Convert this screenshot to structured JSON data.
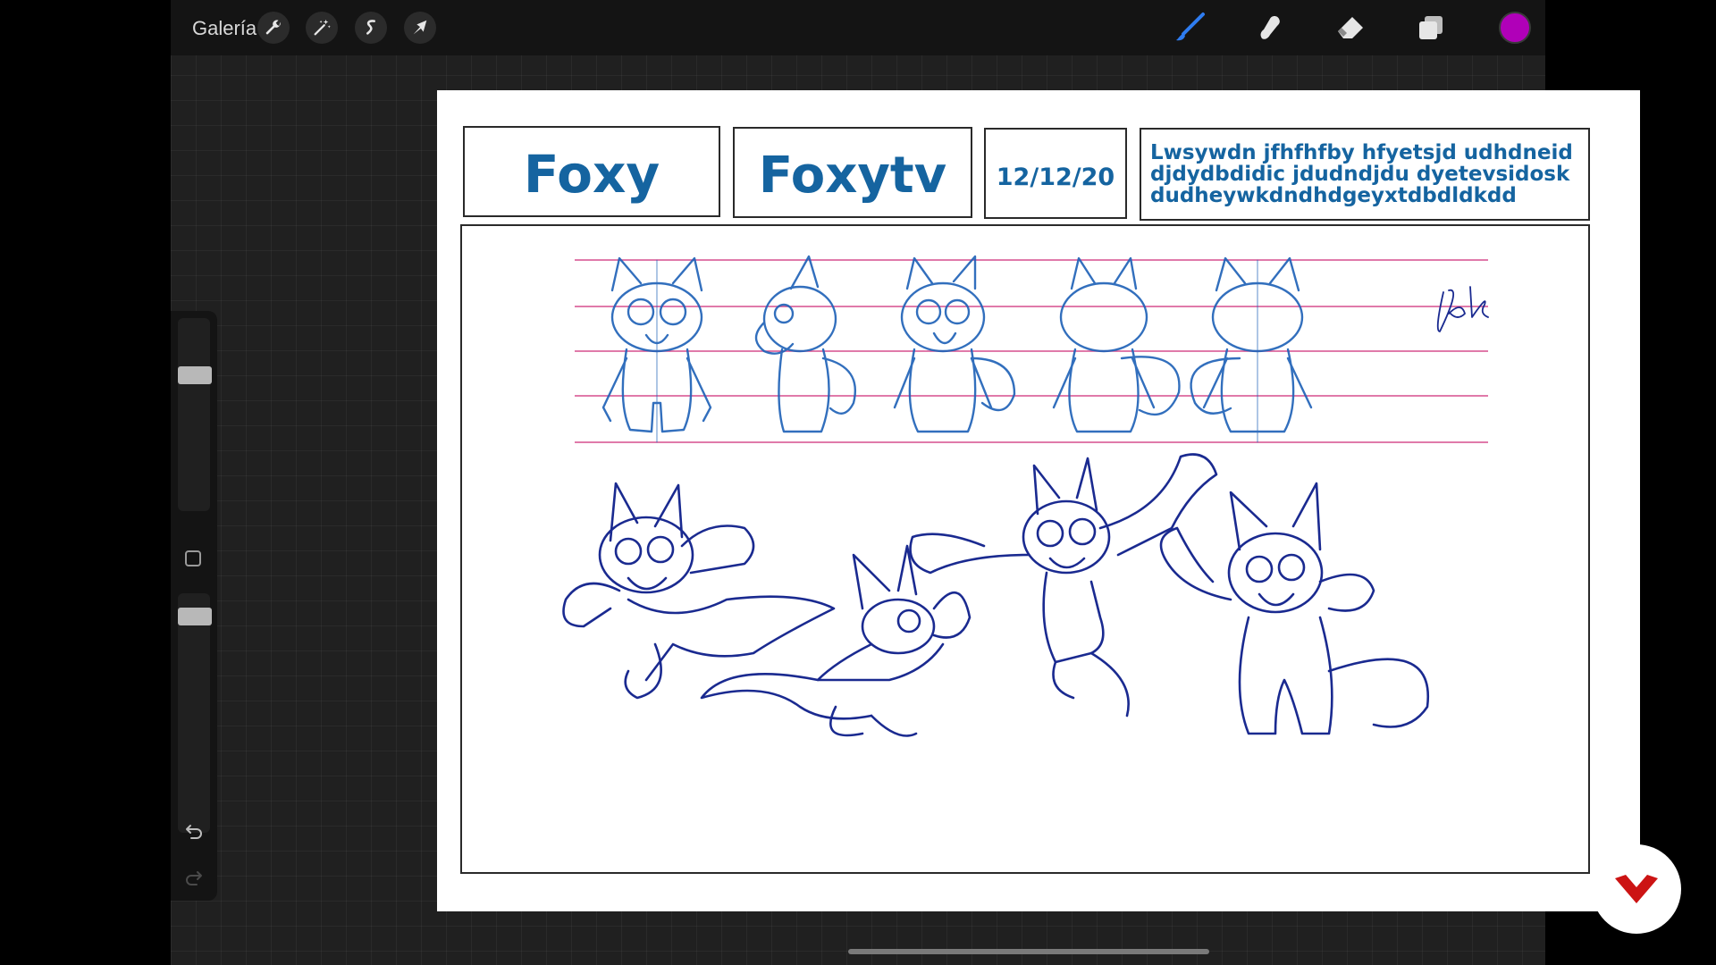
{
  "toolbar": {
    "gallery_label": "Galería",
    "left_tools": [
      "wrench-icon",
      "magic-wand-icon",
      "selection-icon",
      "transform-icon"
    ],
    "right_tools": [
      "brush-icon",
      "smudge-icon",
      "eraser-icon",
      "layers-icon"
    ],
    "current_color": "#b000b8"
  },
  "sidebar": {
    "tools": [
      "brush-size-slider",
      "modify-button",
      "opacity-slider",
      "undo-icon",
      "redo-icon"
    ]
  },
  "sheet": {
    "name": "Foxy",
    "project": "Foxytv",
    "date": "12/12/20",
    "description": "Lwsywdn jfhfhfby hfyetsjd udhdneid djdydbdidic jdudndjdu dyetevsidosk dudheywkdndhdgeyxtdbdldkdd",
    "signature": "Rak",
    "ink_color": "#1564a0",
    "guide_color": "#d0307a"
  },
  "branding": {
    "logo_icon": "domestika-logo-icon",
    "logo_color": "#cc1414"
  }
}
